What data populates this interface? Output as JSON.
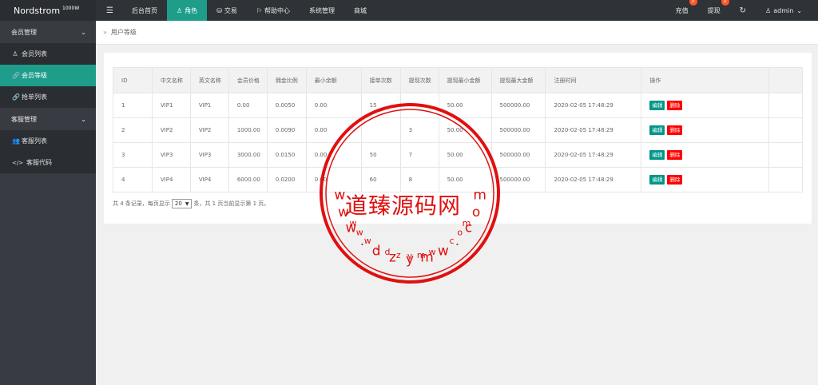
{
  "header": {
    "logo": "Nordstrom",
    "logo_sup": "1000W",
    "menu_toggle": "☰",
    "nav": [
      {
        "label": "后台首页",
        "icon": ""
      },
      {
        "label": "角色",
        "icon": "♙"
      },
      {
        "label": "交易",
        "icon": "⛁"
      },
      {
        "label": "帮助中心",
        "icon": "⚐"
      },
      {
        "label": "系统管理",
        "icon": ""
      },
      {
        "label": "商城",
        "icon": ""
      }
    ],
    "recharge": {
      "label": "充值",
      "badge": "0"
    },
    "withdraw": {
      "label": "提现",
      "badge": "0"
    },
    "refresh_icon": "↻",
    "user": {
      "icon": "♙",
      "label": "admin",
      "caret": "⌄"
    }
  },
  "sidebar": {
    "groups": [
      {
        "label": "会员管理",
        "caret": "⌄",
        "items": [
          {
            "label": "会员列表",
            "icon": "♙"
          },
          {
            "label": "会员等级",
            "icon": "🔗"
          },
          {
            "label": "抢单列表",
            "icon": "🔗"
          }
        ]
      },
      {
        "label": "客服管理",
        "caret": "⌄",
        "items": [
          {
            "label": "客服列表",
            "icon": "👥"
          },
          {
            "label": "客服代码",
            "icon": "</>"
          }
        ]
      }
    ]
  },
  "breadcrumb": {
    "sep": "»",
    "label": "用户等级"
  },
  "table": {
    "headers": [
      "ID",
      "中文名称",
      "英文名称",
      "会员价格",
      "佣金比例",
      "最小余额",
      "接单次数",
      "提现次数",
      "提现最小金额",
      "提现最大金额",
      "注册时间",
      "操作"
    ],
    "rows": [
      [
        "1",
        "VIP1",
        "VIP1",
        "0.00",
        "0.0050",
        "0.00",
        "15",
        "",
        "50.00",
        "500000.00",
        "2020-02-05 17:48:29"
      ],
      [
        "2",
        "VIP2",
        "VIP2",
        "1000.00",
        "0.0090",
        "0.00",
        "",
        "3",
        "50.00",
        "500000.00",
        "2020-02-05 17:48:29"
      ],
      [
        "3",
        "VIP3",
        "VIP3",
        "3000.00",
        "0.0150",
        "0.00",
        "50",
        "7",
        "50.00",
        "500000.00",
        "2020-02-05 17:48:29"
      ],
      [
        "4",
        "VIP4",
        "VIP4",
        "6000.00",
        "0.0200",
        "0.00",
        "60",
        "8",
        "50.00",
        "500000.00",
        "2020-02-05 17:48:29"
      ]
    ],
    "edit_label": "编辑",
    "delete_label": "删除"
  },
  "pager": {
    "prefix": "共 4 条记录，每页显示",
    "page_size": "20",
    "suffix": "条，共 1 页当前显示第 1 页。"
  },
  "watermark": {
    "brand": "道臻源码网",
    "top_letters": [
      "w",
      "w",
      "w",
      ".",
      "d",
      "z",
      "y",
      "m",
      "w",
      ".",
      "c",
      "o",
      "m"
    ],
    "bottom_letters": [
      "w",
      "w",
      "w",
      ".",
      "d",
      "z",
      "y",
      "m",
      "w",
      ".",
      "c",
      "o",
      "m"
    ],
    "color": "#e01010"
  },
  "colors": {
    "accent": "#1e9d8b",
    "header": "#2f3237",
    "sidebar": "#383b41",
    "danger": "#ff0000",
    "edit": "#009688"
  }
}
